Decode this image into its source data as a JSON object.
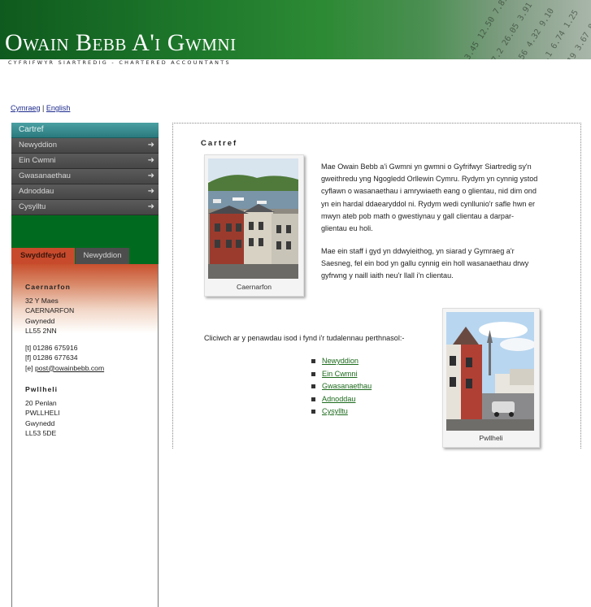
{
  "header": {
    "brand": "Owain Bebb A'i Gwmni",
    "tagline": "CYFRIFWYR SIARTREDIG - CHARTERED ACCOUNTANTS"
  },
  "language": {
    "welsh": "Cymraeg",
    "separator": "|",
    "english": "English"
  },
  "sidebar": {
    "nav_head": "Cartref",
    "items": [
      {
        "label": "Newyddion",
        "icon": "arrow-right-icon"
      },
      {
        "label": "Ein Cwmni",
        "icon": "arrow-right-icon"
      },
      {
        "label": "Gwasanaethau",
        "icon": "arrow-right-icon"
      },
      {
        "label": "Adnoddau",
        "icon": "arrow-right-icon"
      },
      {
        "label": "Cysylltu",
        "icon": "arrow-right-icon"
      }
    ],
    "tabs": {
      "active": "Swyddfeydd",
      "inactive": "Newyddion"
    },
    "offices": [
      {
        "town": "Caernarfon",
        "address": [
          "32 Y Maes",
          "CAERNARFON",
          "Gwynedd",
          "LL55 2NN"
        ],
        "tel": "[t] 01286 675916",
        "fax": "[f] 01286 677634",
        "email_prefix": "[e] ",
        "email": "post@owainbebb.com"
      },
      {
        "town": "Pwllheli",
        "address": [
          "20 Penlan",
          "PWLLHELI",
          "Gwynedd",
          "LL53 5DE"
        ]
      }
    ]
  },
  "main": {
    "title": "Cartref",
    "photo1_caption": "Caernarfon",
    "photo2_caption": "Pwllheli",
    "paragraph1": "Mae Owain Bebb a'i Gwmni yn gwmni o Gyfrifwyr Siartredig sy'n gweithredu yng Ngogledd Orllewin Cymru.  Rydym yn cynnig ystod cyflawn o wasanaethau i amrywiaeth eang o glientau, nid dim ond yn ein hardal ddaearyddol ni.  Rydym wedi cynllunio'r safle hwn er mwyn ateb pob math o gwestiynau y gall clientau a darpar-glientau eu holi.",
    "paragraph2": "Mae ein staff i gyd yn ddwyieithog, yn siarad y Gymraeg a'r Saesneg, fel ein bod yn gallu cynnig ein holl wasanaethau drwy gyfrwng y naill iaith neu'r llall i'n clientau.",
    "intro": "Cliciwch ar y penawdau isod i fynd i'r tudalennau perthnasol:-",
    "links": [
      "Newyddion",
      "Ein Cwmni",
      "Gwasanaethau",
      "Adnoddau",
      "Cysylltu"
    ]
  },
  "colors": {
    "brand_green": "#006b1e",
    "nav_grey": "#4d4d4d",
    "tab_active": "#c74a2c",
    "link_green": "#1c6a1c"
  }
}
